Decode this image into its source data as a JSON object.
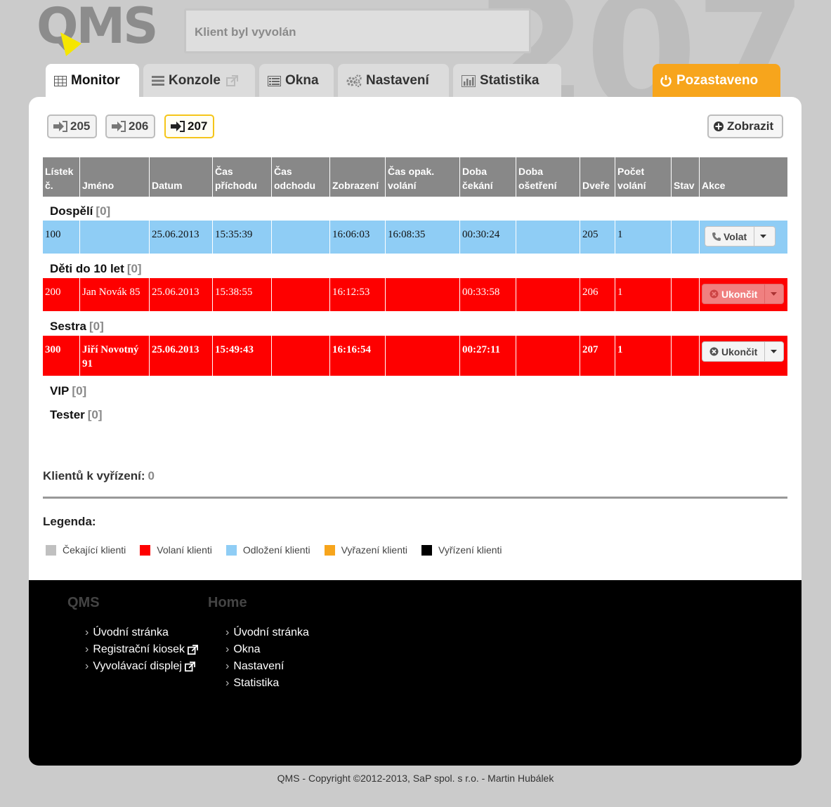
{
  "header": {
    "logo_text": "QMS",
    "status_message": "Klient byl vyvolán",
    "window_number": "207"
  },
  "tabs": [
    {
      "label": "Monitor",
      "icon": "table-icon",
      "active": true
    },
    {
      "label": "Konzole",
      "icon": "list-icon",
      "active": false
    },
    {
      "label": "Okna",
      "icon": "window-list-icon",
      "active": false
    },
    {
      "label": "Nastavení",
      "icon": "gears-icon",
      "active": false
    },
    {
      "label": "Statistika",
      "icon": "bar-chart-icon",
      "active": false
    }
  ],
  "pause_button": {
    "label": "Pozastaveno",
    "icon": "power-icon",
    "color": "#f7a51c"
  },
  "windows": [
    {
      "label": "205",
      "active": false
    },
    {
      "label": "206",
      "active": false
    },
    {
      "label": "207",
      "active": true
    }
  ],
  "show_button": {
    "label": "Zobrazit"
  },
  "table": {
    "columns": [
      "Lístek č.",
      "Jméno",
      "Datum",
      "Čas příchodu",
      "Čas odchodu",
      "Zobrazení",
      "Čas opak. volání",
      "Doba čekání",
      "Doba ošetření",
      "Dveře",
      "Počet volání",
      "Stav",
      "Akce"
    ],
    "groups": [
      {
        "name": "Dospělí",
        "count": "[0]",
        "rows": [
          {
            "ticket": "100",
            "name": "",
            "date": "25.06.2013",
            "arrival": "15:35:39",
            "departure": "",
            "shown": "16:06:03",
            "recall": "16:08:35",
            "wait": "00:30:24",
            "treatment": "",
            "door": "205",
            "calls": "1",
            "state": "",
            "action": "Volat"
          }
        ]
      },
      {
        "name": "Děti do 10 let",
        "count": "[0]",
        "rows": [
          {
            "ticket": "200",
            "name": "Jan Novák 85",
            "date": "25.06.2013",
            "arrival": "15:38:55",
            "departure": "",
            "shown": "16:12:53",
            "recall": "",
            "wait": "00:33:58",
            "treatment": "",
            "door": "206",
            "calls": "1",
            "state": "",
            "action": "Ukončit"
          }
        ]
      },
      {
        "name": "Sestra",
        "count": "[0]",
        "rows": [
          {
            "ticket": "300",
            "name": "Jiří Novotný 91",
            "date": "25.06.2013",
            "arrival": "15:49:43",
            "departure": "",
            "shown": "16:16:54",
            "recall": "",
            "wait": "00:27:11",
            "treatment": "",
            "door": "207",
            "calls": "1",
            "state": "",
            "action": "Ukončit"
          }
        ]
      },
      {
        "name": "VIP",
        "count": "[0]",
        "rows": []
      },
      {
        "name": "Tester",
        "count": "[0]",
        "rows": []
      }
    ]
  },
  "summary": {
    "label": "Klientů k vyřízení:",
    "value": "0"
  },
  "legend": {
    "title": "Legenda:",
    "items": [
      {
        "label": "Čekající klienti",
        "color": "#c0c0c0"
      },
      {
        "label": "Volaní klienti",
        "color": "#fe0000"
      },
      {
        "label": "Odložení klienti",
        "color": "#8fcdf5"
      },
      {
        "label": "Vyřazení klienti",
        "color": "#f7a51c"
      },
      {
        "label": "Vyřízení klienti",
        "color": "#000000"
      }
    ]
  },
  "footer": {
    "col1": {
      "title": "QMS",
      "links": [
        "Úvodní stránka",
        "Registrační kiosek",
        "Vyvolávací displej"
      ]
    },
    "col2": {
      "title": "Home",
      "links": [
        "Úvodní stránka",
        "Okna",
        "Nastavení",
        "Statistika"
      ]
    }
  },
  "copyright": "QMS - Copyright ©2012-2013, SaP spol. s r.o. - Martin Hubálek"
}
